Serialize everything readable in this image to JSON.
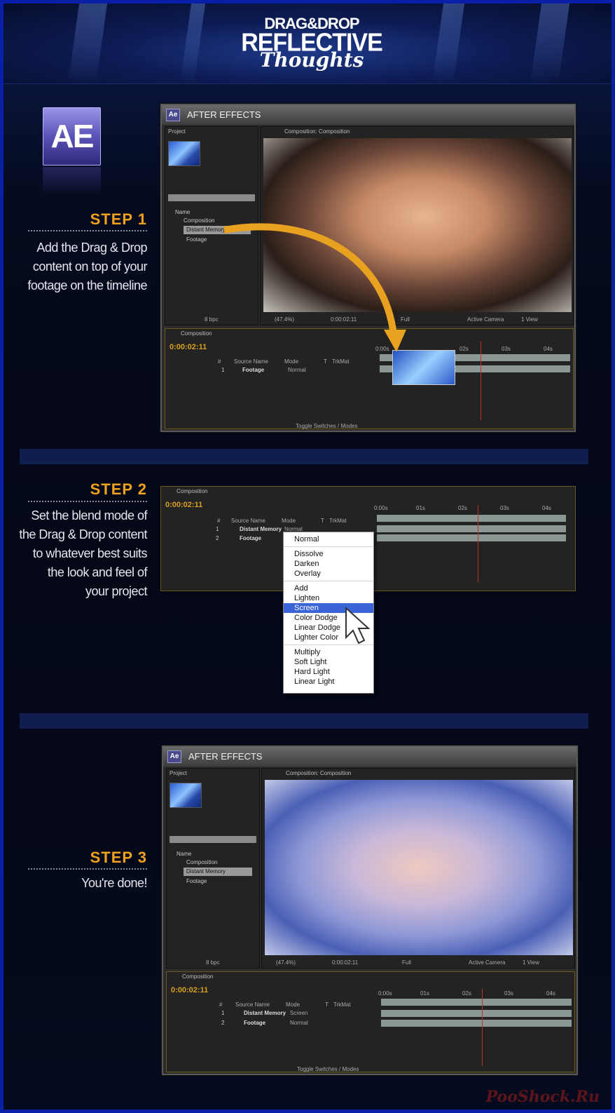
{
  "header": {
    "line1": "DRAG&DROP",
    "line2": "REFLECTIVE",
    "line3": "Thoughts"
  },
  "ae_icon": "AE",
  "steps": [
    {
      "title": "STEP 1",
      "text": [
        "Add the Drag & Drop",
        "content on top of your",
        "footage on the timeline"
      ]
    },
    {
      "title": "STEP 2",
      "text": [
        "Set the blend mode of",
        "the Drag & Drop content",
        "to whatever best suits",
        "the  look and feel of",
        "your project"
      ]
    },
    {
      "title": "STEP 3",
      "text": [
        "You're done!"
      ]
    }
  ],
  "ae": {
    "badge": "Ae",
    "window_title": "AFTER EFFECTS",
    "project_tab": "Project",
    "composition_tab": "Composition: Composition",
    "timeline_tab": "Composition",
    "name_header": "Name",
    "items": [
      "Composition",
      "Distant Memory",
      "Footage"
    ],
    "bpc": "8 bpc",
    "zoom": "(47.4%)",
    "timecode_small": "0:00:02:11",
    "resolution": "Full",
    "camera": "Active Camera",
    "views": "1 View",
    "timecode": "0:00:02:11",
    "col_num": "#",
    "col_source": "Source Name",
    "col_mode": "Mode",
    "col_t": "T",
    "col_trkmat": "TrkMat",
    "toggle": "Toggle Switches / Modes",
    "ticks": [
      "0:00s",
      "01s",
      "02s",
      "03s",
      "04s"
    ],
    "layer_footage": "Footage",
    "layer_distant": "Distant Memory",
    "mode_normal": "Normal",
    "mode_screen": "Screen"
  },
  "blend_menu": {
    "groups": [
      [
        "Normal"
      ],
      [
        "Dissolve",
        "Darken",
        "Overlay"
      ],
      [
        "Add",
        "Lighten",
        "Screen",
        "Color Dodge",
        "Linear Dodge",
        "Lighter Color"
      ],
      [
        "Multiply",
        "Soft Light",
        "Hard Light",
        "Linear Light"
      ]
    ],
    "selected": "Screen"
  },
  "watermark": "PooShock.Ru",
  "colors": {
    "accent": "#f0a21e",
    "border": "#0a1fa8",
    "timecode": "#d9a021",
    "menu_highlight": "#3a64d8"
  }
}
